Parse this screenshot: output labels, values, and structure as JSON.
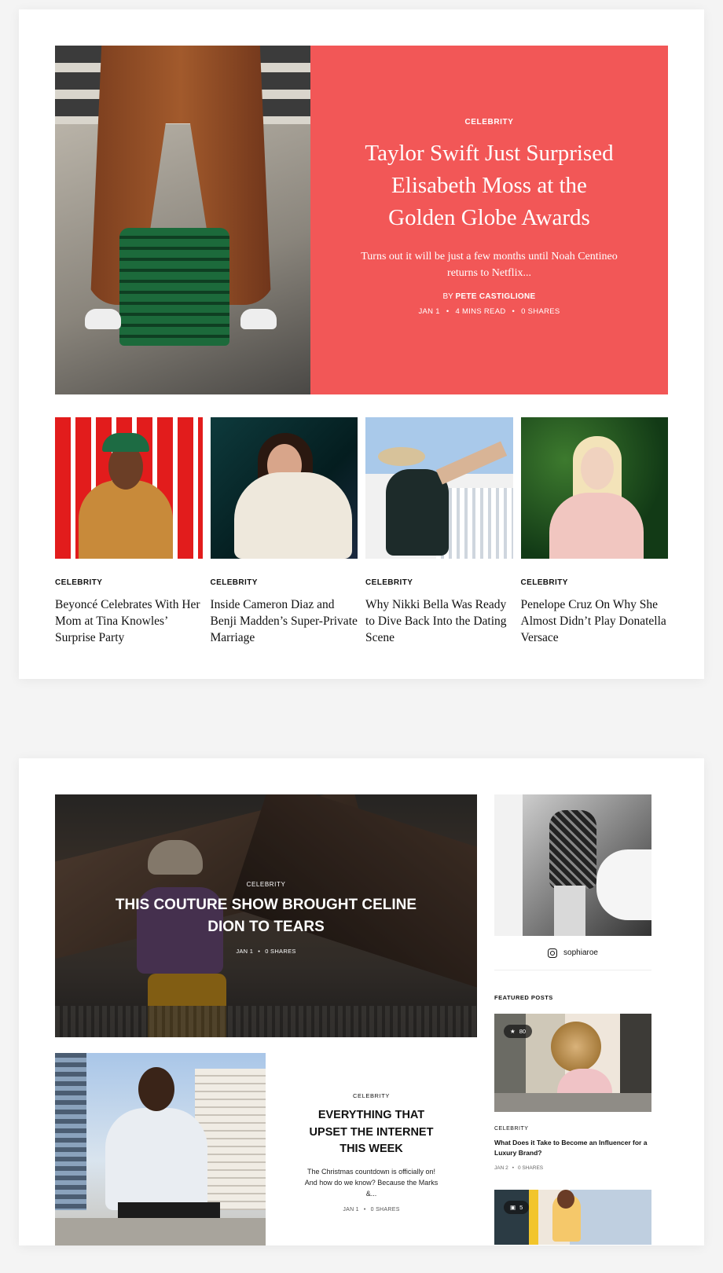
{
  "hero": {
    "category": "CELEBRITY",
    "title": "Taylor Swift Just Surprised Elisabeth Moss at the Golden Globe Awards",
    "excerpt": "Turns out it will be just a few months until Noah Centineo returns to Netflix...",
    "author_prefix": "BY",
    "author": "PETE CASTIGLIONE",
    "date": "JAN 1",
    "read_time": "4 MINS READ",
    "shares": "0 SHARES",
    "accent": "#f25757"
  },
  "grid": [
    {
      "category": "CELEBRITY",
      "title": "Beyoncé Celebrates With Her Mom at Tina Knowles’ Surprise Party"
    },
    {
      "category": "CELEBRITY",
      "title": "Inside Cameron Diaz and Benji Madden’s Super-Private Marriage"
    },
    {
      "category": "CELEBRITY",
      "title": "Why Nikki Bella Was Ready to Dive Back Into the Dating Scene"
    },
    {
      "category": "CELEBRITY",
      "title": "Penelope Cruz On Why She Almost Didn’t Play Donatella Versace"
    }
  ],
  "featured": {
    "category": "CELEBRITY",
    "title": "THIS COUTURE SHOW BROUGHT CELINE DION TO TEARS",
    "date": "JAN 1",
    "shares": "0 SHARES"
  },
  "post2": {
    "category": "CELEBRITY",
    "title": "EVERYTHING THAT UPSET THE INTERNET THIS WEEK",
    "excerpt": "The Christmas countdown is officially on! And how do we know? Because the Marks &...",
    "date": "JAN 1",
    "shares": "0 SHARES"
  },
  "sidebar": {
    "instagram_handle": "sophiaroe",
    "instagram_icon": "instagram-icon",
    "featured_heading": "FEATURED POSTS",
    "post1": {
      "badge_count": "80",
      "badge_icon": "star-icon",
      "category": "CELEBRITY",
      "title": "What Does it Take to Become an Influencer for a Luxury Brand?",
      "date": "JAN 2",
      "shares": "0 SHARES"
    },
    "post2": {
      "badge_count": "5",
      "badge_icon": "image-icon"
    }
  }
}
